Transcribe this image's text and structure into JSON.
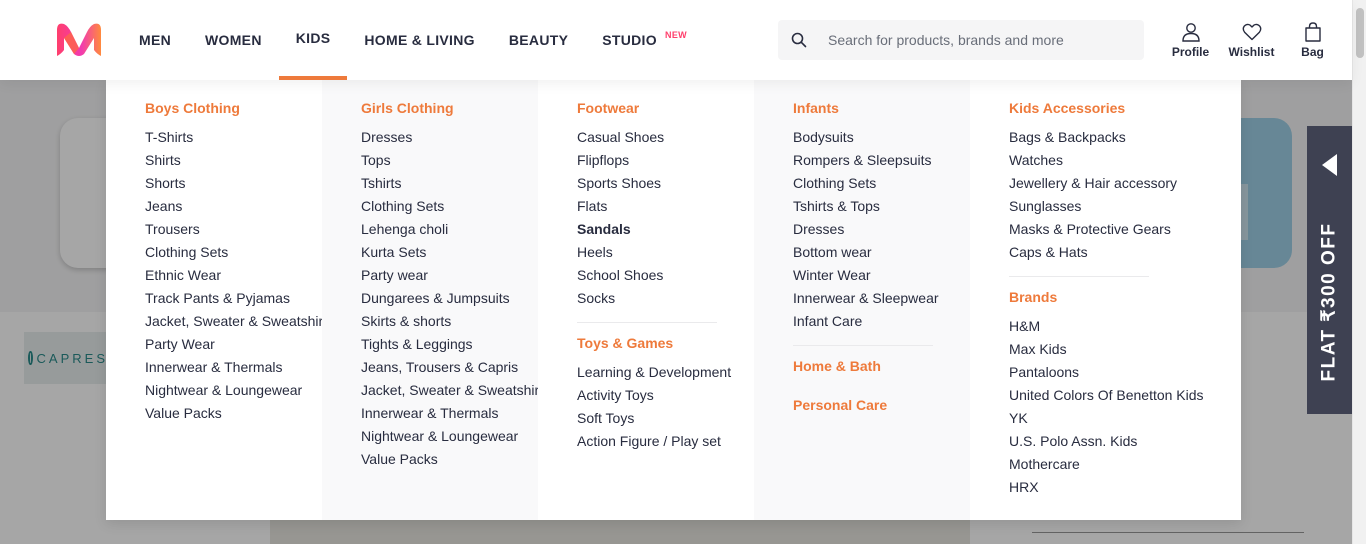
{
  "nav": {
    "men": "MEN",
    "women": "WOMEN",
    "kids": "KIDS",
    "home_living": "HOME & LIVING",
    "beauty": "BEAUTY",
    "studio": "STUDIO",
    "studio_badge": "NEW"
  },
  "search": {
    "placeholder": "Search for products, brands and more"
  },
  "actions": {
    "profile": "Profile",
    "wishlist": "Wishlist",
    "bag": "Bag"
  },
  "background": {
    "brand_logo_text": "CAPRES"
  },
  "promo": {
    "text": "FLAT ₹300 OFF"
  },
  "colors": {
    "accent": "#ee7a3b",
    "brand_pink": "#ff3f6c",
    "text": "#282c3f",
    "promo_bg": "#3e4152"
  },
  "menu": {
    "col1": {
      "boys_clothing": {
        "title": "Boys Clothing",
        "items": [
          "T-Shirts",
          "Shirts",
          "Shorts",
          "Jeans",
          "Trousers",
          "Clothing Sets",
          "Ethnic Wear",
          "Track Pants & Pyjamas",
          "Jacket, Sweater & Sweatshirts",
          "Party Wear",
          "Innerwear & Thermals",
          "Nightwear & Loungewear",
          "Value Packs"
        ]
      }
    },
    "col2": {
      "girls_clothing": {
        "title": "Girls Clothing",
        "items": [
          "Dresses",
          "Tops",
          "Tshirts",
          "Clothing Sets",
          "Lehenga choli",
          "Kurta Sets",
          "Party wear",
          "Dungarees & Jumpsuits",
          "Skirts & shorts",
          "Tights & Leggings",
          "Jeans, Trousers & Capris",
          "Jacket, Sweater & Sweatshirts",
          "Innerwear & Thermals",
          "Nightwear & Loungewear",
          "Value Packs"
        ]
      }
    },
    "col3": {
      "footwear": {
        "title": "Footwear",
        "items": [
          "Casual Shoes",
          "Flipflops",
          "Sports Shoes",
          "Flats",
          "Sandals",
          "Heels",
          "School Shoes",
          "Socks"
        ]
      },
      "toys_games": {
        "title": "Toys & Games",
        "items": [
          "Learning & Development",
          "Activity Toys",
          "Soft Toys",
          "Action Figure / Play set"
        ]
      }
    },
    "col4": {
      "infants": {
        "title": "Infants",
        "items": [
          "Bodysuits",
          "Rompers & Sleepsuits",
          "Clothing Sets",
          "Tshirts & Tops",
          "Dresses",
          "Bottom wear",
          "Winter Wear",
          "Innerwear & Sleepwear",
          "Infant Care"
        ]
      },
      "home_bath": {
        "title": "Home & Bath"
      },
      "personal_care": {
        "title": "Personal Care"
      }
    },
    "col5": {
      "kids_accessories": {
        "title": "Kids Accessories",
        "items": [
          "Bags & Backpacks",
          "Watches",
          "Jewellery & Hair accessory",
          "Sunglasses",
          "Masks & Protective Gears",
          "Caps & Hats"
        ]
      },
      "brands": {
        "title": "Brands",
        "items": [
          "H&M",
          "Max Kids",
          "Pantaloons",
          "United Colors Of Benetton Kids",
          "YK",
          "U.S. Polo Assn. Kids",
          "Mothercare",
          "HRX"
        ]
      }
    }
  }
}
